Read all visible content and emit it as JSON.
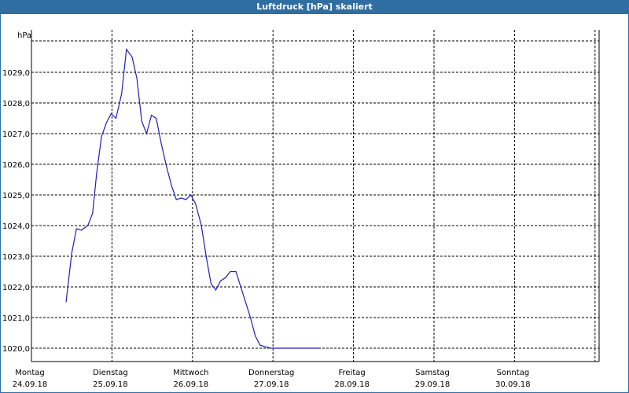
{
  "window": {
    "title": "Luftdruck [hPa] skaliert"
  },
  "colors": {
    "titlebar": "#2f6ea3",
    "line": "#1f1fb4",
    "grid": "#000000",
    "background": "#ffffff"
  },
  "chart_data": {
    "type": "line",
    "title": "Luftdruck [hPa] skaliert",
    "ylabel": "hPa",
    "xlabel": "",
    "grid": true,
    "ylim": [
      1019.7,
      1030.8
    ],
    "yticks": [
      1020.0,
      1021.0,
      1022.0,
      1023.0,
      1024.0,
      1025.0,
      1026.0,
      1027.0,
      1028.0,
      1029.0
    ],
    "ytick_labels": [
      "1020,0",
      "1021,0",
      "1022,0",
      "1023,0",
      "1024,0",
      "1025,0",
      "1026,0",
      "1027,0",
      "1028,0",
      "1029,0"
    ],
    "xlim": [
      0,
      7
    ],
    "x_categories": [
      {
        "day": "Montag",
        "date": "24.09.18"
      },
      {
        "day": "Dienstag",
        "date": "25.09.18"
      },
      {
        "day": "Mittwoch",
        "date": "26.09.18"
      },
      {
        "day": "Donnerstag",
        "date": "27.09.18"
      },
      {
        "day": "Freitag",
        "date": "28.09.18"
      },
      {
        "day": "Samstag",
        "date": "29.09.18"
      },
      {
        "day": "Sonntag",
        "date": "30.09.18"
      }
    ],
    "series": [
      {
        "x": [
          0.43,
          0.5,
          0.56,
          0.62,
          0.7,
          0.76,
          0.81,
          0.87,
          0.93,
          0.99,
          1.05,
          1.12,
          1.18,
          1.25,
          1.31,
          1.37,
          1.43,
          1.49,
          1.55,
          1.61,
          1.68,
          1.74,
          1.8,
          1.86,
          1.92,
          1.98,
          2.04,
          2.11,
          2.17,
          2.23,
          2.29,
          2.35,
          2.41,
          2.47,
          2.54,
          2.6,
          2.66,
          2.72,
          2.78,
          2.84,
          2.9,
          2.97,
          3.03,
          3.09,
          3.15,
          3.21,
          3.27,
          3.33,
          3.4,
          3.46,
          3.52,
          3.58
        ],
        "y": [
          1021.5,
          1023.1,
          1023.9,
          1023.85,
          1024.0,
          1024.4,
          1025.7,
          1026.9,
          1027.35,
          1027.65,
          1027.5,
          1028.3,
          1029.75,
          1029.5,
          1028.8,
          1027.4,
          1027.0,
          1027.6,
          1027.5,
          1026.7,
          1025.9,
          1025.3,
          1024.85,
          1024.9,
          1024.85,
          1025.0,
          1024.7,
          1024.0,
          1023.0,
          1022.1,
          1021.9,
          1022.2,
          1022.3,
          1022.5,
          1022.5,
          1022.0,
          1021.5,
          1021.0,
          1020.4,
          1020.1,
          1020.05,
          1020.0,
          1020.0,
          1020.0,
          1020.0,
          1020.0,
          1020.0,
          1020.0,
          1020.0,
          1020.0,
          1020.0,
          1020.0
        ]
      }
    ]
  }
}
